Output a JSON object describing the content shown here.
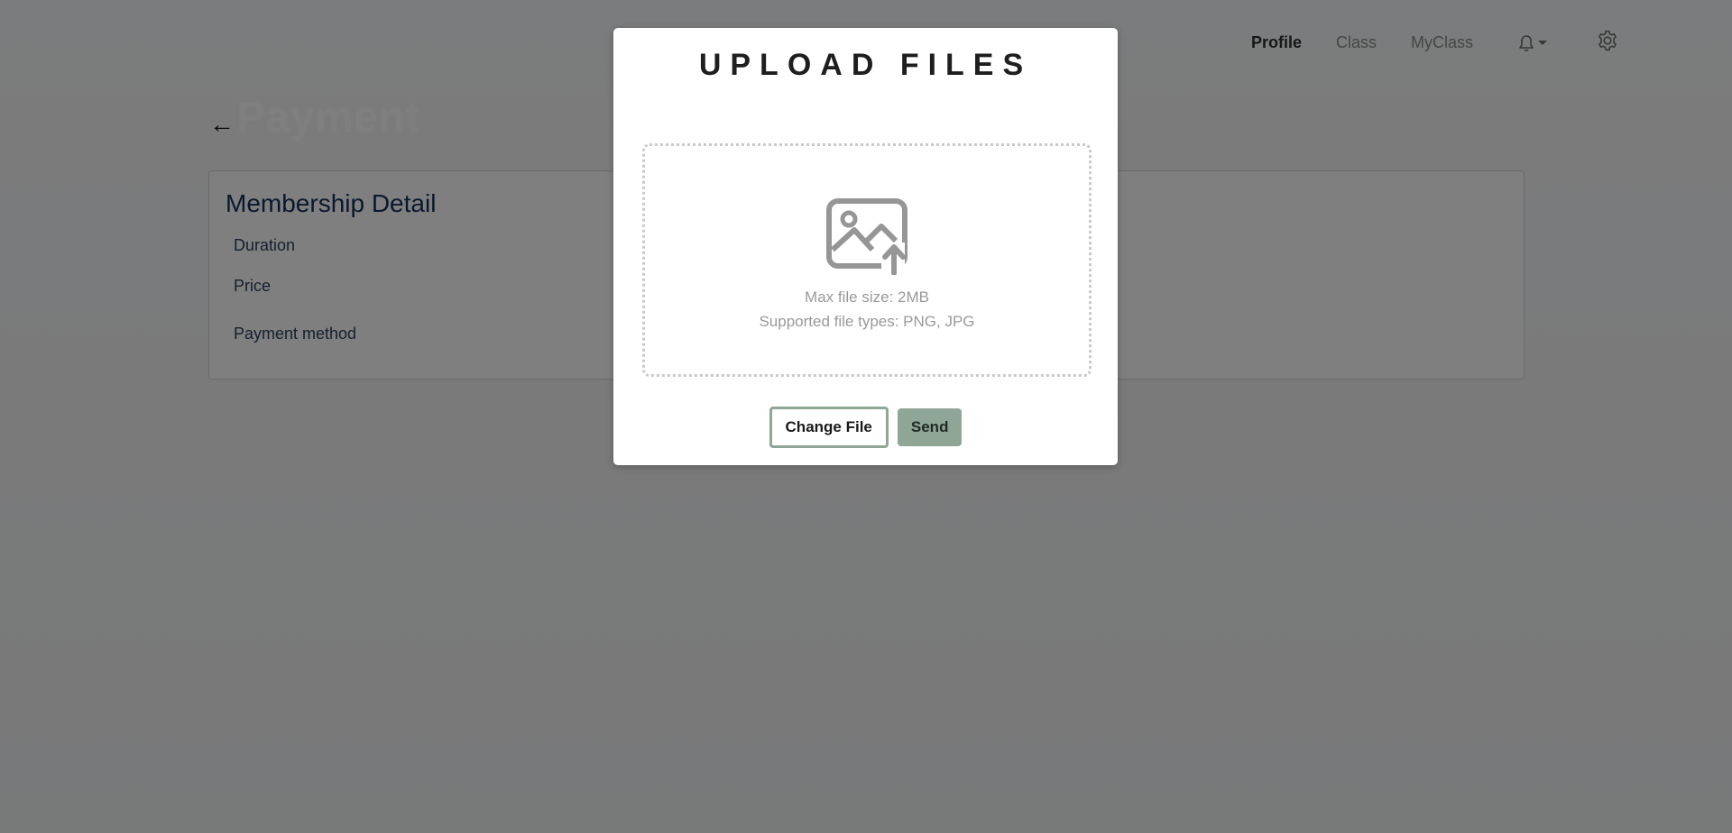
{
  "navbar": {
    "links": [
      {
        "label": "Profile",
        "active": true
      },
      {
        "label": "Class",
        "active": false
      },
      {
        "label": "MyClass",
        "active": false
      }
    ],
    "icons": {
      "notifications": "bell-icon",
      "settings": "gear-icon"
    }
  },
  "page": {
    "back_icon": "←",
    "title": "Payment"
  },
  "membership": {
    "title": "Membership Detail",
    "labels": [
      "Duration",
      "Price",
      "Payment method"
    ]
  },
  "modal": {
    "title": "UPLOAD FILES",
    "icon": "image-upload-icon",
    "max_size": "Max file size: 2MB",
    "file_types": "Supported file types: PNG, JPG",
    "change_button": "Change File",
    "send_button": "Send"
  },
  "colors": {
    "accent": "#8fa596",
    "title_blue": "#13315c"
  }
}
